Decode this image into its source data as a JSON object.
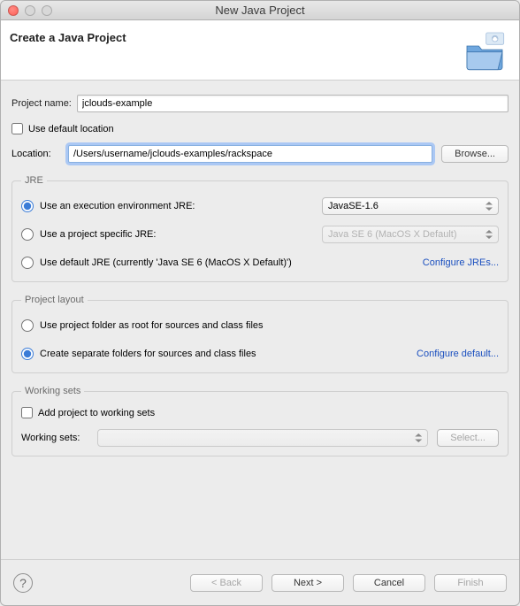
{
  "window": {
    "title": "New Java Project"
  },
  "banner": {
    "heading": "Create a Java Project"
  },
  "form": {
    "project_name_label": "Project name:",
    "project_name_value": "jclouds-example",
    "use_default_location": "Use default location",
    "location_label": "Location:",
    "location_value": "/Users/username/jclouds-examples/rackspace",
    "browse": "Browse..."
  },
  "jre": {
    "legend": "JRE",
    "exec_env_label": "Use an execution environment JRE:",
    "exec_env_value": "JavaSE-1.6",
    "project_specific_label": "Use a project specific JRE:",
    "project_specific_value": "Java SE 6 (MacOS X Default)",
    "default_jre_label": "Use default JRE (currently 'Java SE 6 (MacOS X Default)')",
    "configure_link": "Configure JREs..."
  },
  "layout": {
    "legend": "Project layout",
    "use_root": "Use project folder as root for sources and class files",
    "separate": "Create separate folders for sources and class files",
    "configure_link": "Configure default..."
  },
  "ws": {
    "legend": "Working sets",
    "add_label": "Add project to working sets",
    "sets_label": "Working sets:",
    "select": "Select..."
  },
  "buttons": {
    "back": "< Back",
    "next": "Next >",
    "cancel": "Cancel",
    "finish": "Finish"
  }
}
